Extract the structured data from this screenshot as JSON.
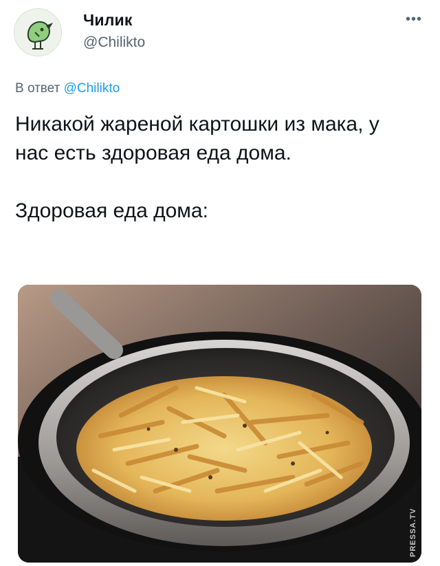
{
  "tweet": {
    "author_name": "Чилик",
    "author_handle": "@Chilikto",
    "more_icon": "more-options-icon",
    "reply_prefix": "В ответ",
    "reply_mention": "@Chilikto",
    "text_paragraph_1": "Никакой жареной картошки из мака, у нас есть здоровая еда дома.",
    "text_paragraph_2": "Здоровая еда дома:"
  },
  "media": {
    "description_icon": "fried-potatoes-in-pan-photo",
    "watermark": "PRESSA.TV"
  },
  "colors": {
    "link": "#1d9bf0",
    "secondary": "#536471",
    "primary": "#0f1419"
  }
}
